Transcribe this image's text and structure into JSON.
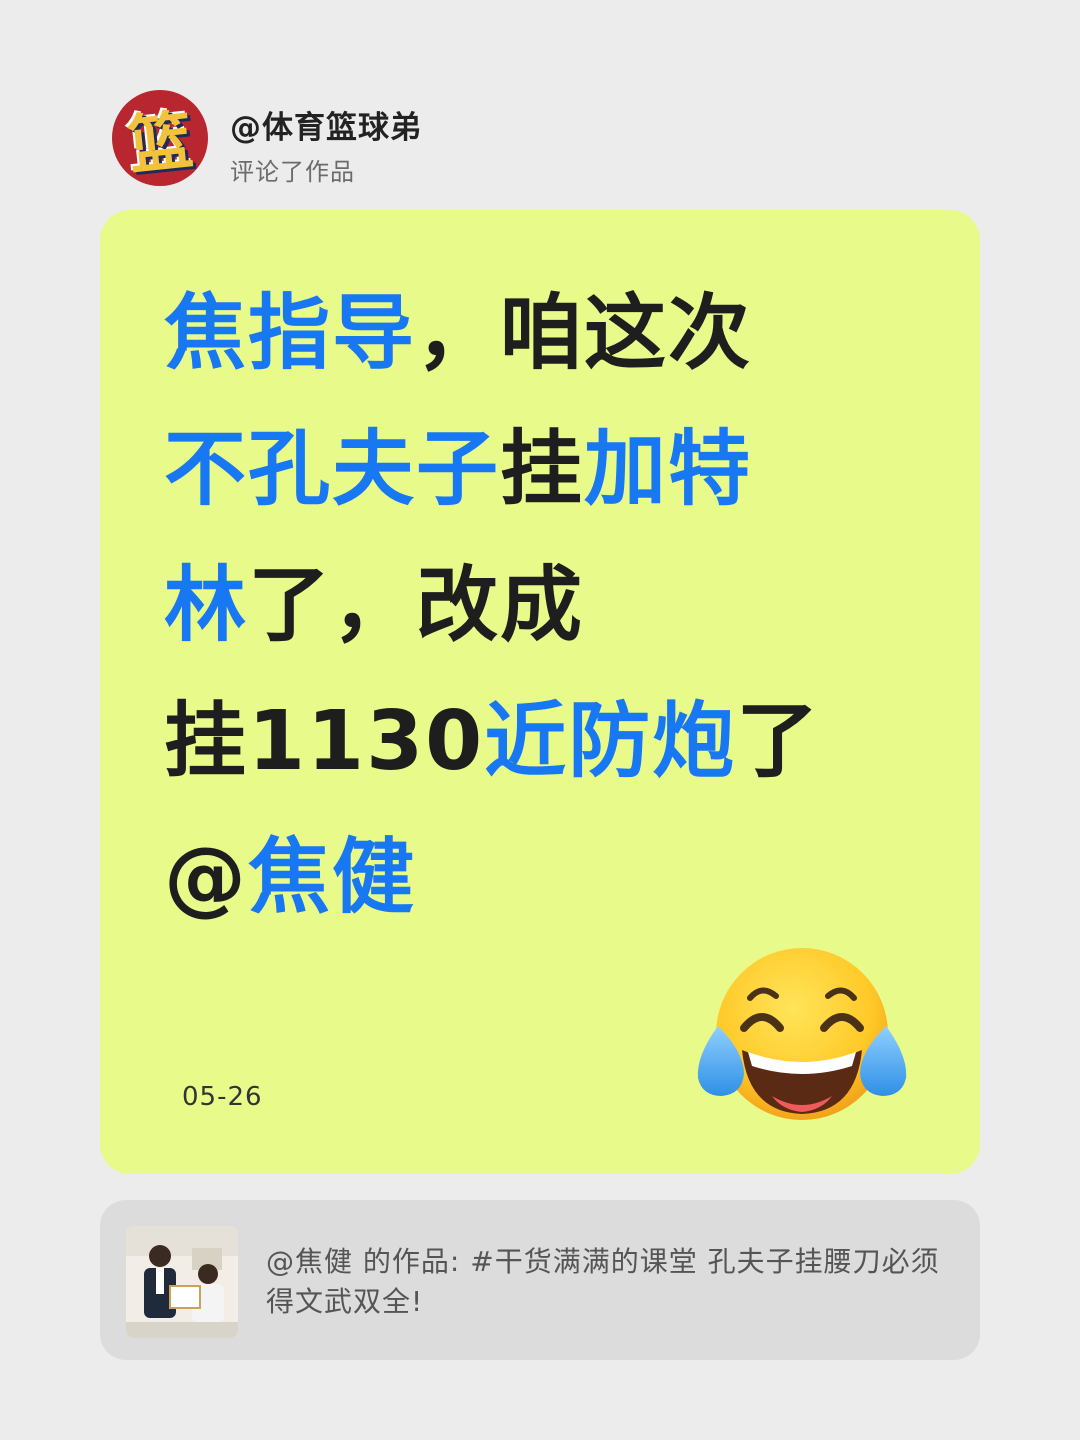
{
  "header": {
    "username": "@体育篮球弟",
    "action": "评论了作品",
    "avatar_glyph": "篮"
  },
  "comment": {
    "lines": [
      [
        {
          "text": "焦指导",
          "style": "hl"
        },
        {
          "text": "，咱这次",
          "style": "dk"
        }
      ],
      [
        {
          "text": "不孔夫子",
          "style": "hl"
        },
        {
          "text": "挂",
          "style": "dk"
        },
        {
          "text": "加特",
          "style": "hl"
        }
      ],
      [
        {
          "text": "林",
          "style": "hl"
        },
        {
          "text": "了，改成",
          "style": "dk"
        }
      ],
      [
        {
          "text": "挂1130",
          "style": "dk"
        },
        {
          "text": "近防炮",
          "style": "hl"
        },
        {
          "text": "了",
          "style": "dk"
        }
      ],
      [
        {
          "text": "@",
          "style": "dk"
        },
        {
          "text": "焦健",
          "style": "hl"
        }
      ]
    ],
    "date": "05-26",
    "emoji": "tears-of-joy-icon"
  },
  "work_card": {
    "text": "@焦健 的作品: #干货满满的课堂 孔夫子挂腰刀必须得文武双全!"
  },
  "colors": {
    "background": "#ececec",
    "card_background": "#e8fa8a",
    "highlight": "#1877f2",
    "text_dark": "#1e1e1e",
    "work_card_background": "#dcdcdc"
  }
}
